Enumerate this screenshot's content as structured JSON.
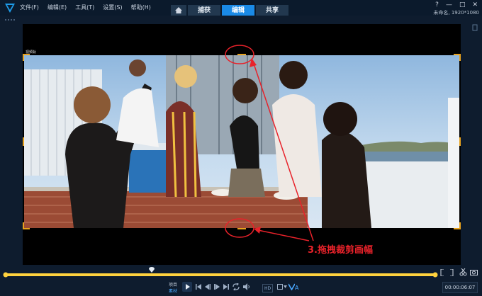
{
  "titlebar": {
    "menu": [
      "文件(F)",
      "编辑(E)",
      "工具(T)",
      "设置(S)",
      "帮助(H)"
    ],
    "tabs": [
      {
        "label": "捕获",
        "active": false
      },
      {
        "label": "编辑",
        "active": true
      },
      {
        "label": "共享",
        "active": false
      }
    ],
    "home_icon": "home-icon",
    "project_info": "未命名, 1920*1080",
    "window_buttons": [
      "?",
      "—",
      "□",
      "✕"
    ]
  },
  "preview": {
    "overlay_label": "视频轨",
    "crop_handle_color": "#e8a21c"
  },
  "annotation": {
    "text": "3.拖拽裁剪画幅",
    "color": "#e8222a"
  },
  "playback": {
    "mode_project": "项目",
    "mode_clip": "素材",
    "timecode": "00:00:06:07",
    "progress": 0.34,
    "accent": "#ffd23e",
    "buttons": [
      "play-icon",
      "start-icon",
      "prev-frame-icon",
      "next-frame-icon",
      "end-icon",
      "repeat-icon",
      "volume-icon"
    ],
    "right_tools": [
      "mark-in-icon",
      "mark-out-icon",
      "split-icon",
      "snapshot-icon"
    ],
    "format_badge": "HD",
    "zoom_label": "A"
  }
}
